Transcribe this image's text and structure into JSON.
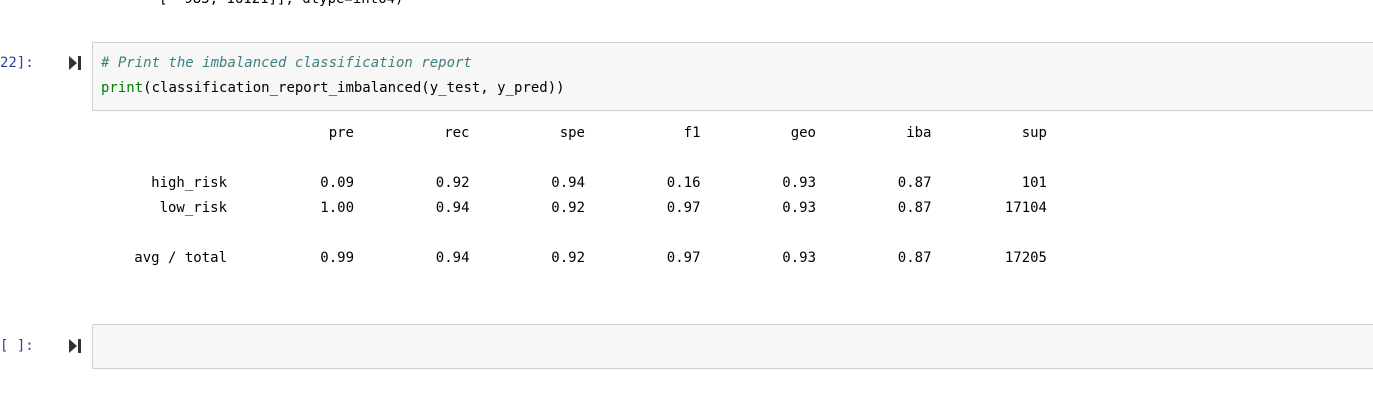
{
  "previous_output": {
    "text": "       [  983, 16121]], dtype=int64)"
  },
  "cell_22": {
    "prompt": "22]:",
    "code_comment": "# Print the imbalanced classification report",
    "code_print": "print",
    "code_rest": "(classification_report_imbalanced(y_test, y_pred))"
  },
  "report": {
    "headers": [
      "pre",
      "rec",
      "spe",
      "f1",
      "geo",
      "iba",
      "sup"
    ],
    "rows": [
      {
        "label": "high_risk",
        "values": [
          "0.09",
          "0.92",
          "0.94",
          "0.16",
          "0.93",
          "0.87",
          "101"
        ]
      },
      {
        "label": "low_risk",
        "values": [
          "1.00",
          "0.94",
          "0.92",
          "0.97",
          "0.93",
          "0.87",
          "17104"
        ]
      }
    ],
    "total": {
      "label": "avg / total",
      "values": [
        "0.99",
        "0.94",
        "0.92",
        "0.97",
        "0.93",
        "0.87",
        "17205"
      ]
    }
  },
  "cell_empty": {
    "prompt": "[ ]:"
  },
  "colors": {
    "prompt": "#303f9f",
    "comment": "#408080",
    "builtin": "#008000",
    "input_bg": "#f7f7f7"
  }
}
